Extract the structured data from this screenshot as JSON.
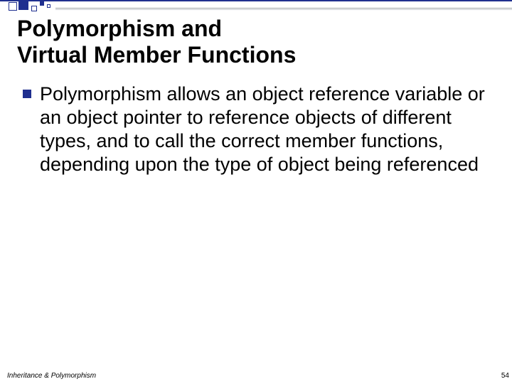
{
  "title_line1": "Polymorphism and",
  "title_line2": "Virtual Member Functions",
  "bullet_text": "Polymorphism allows an object reference variable or an object pointer to reference objects of different types, and to call the correct member functions, depending upon the type of object being referenced",
  "footer_left": "Inheritance & Polymorphism",
  "footer_right": "54"
}
